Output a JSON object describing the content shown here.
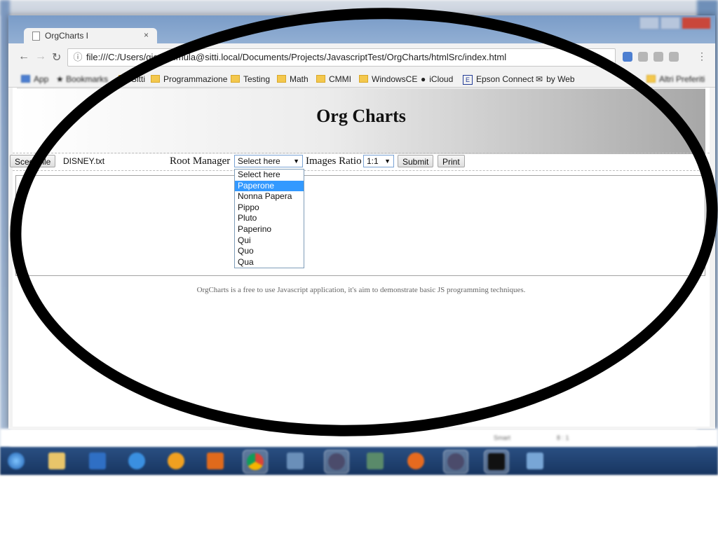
{
  "browser": {
    "tab_title": "OrgCharts I",
    "tab_close": "×",
    "url": "file:///C:/Users/giorgio.mula@sitti.local/Documents/Projects/JavascriptTest/OrgCharts/htmlSrc/index.html",
    "info_glyph": "ⓘ",
    "bookmarks": [
      "App",
      "Bookmarks",
      "Sitti",
      "Programmazione",
      "Testing",
      "Math",
      "CMMI",
      "WindowsCE",
      "iCloud",
      "Epson Connect",
      "by Web",
      "Altri Preferiti"
    ]
  },
  "page": {
    "title": "Org Charts",
    "file_button": "Scegli file",
    "file_name": "DISNEY.txt",
    "root_manager_label": "Root Manager",
    "root_manager_value": "Select here",
    "images_ratio_label": "Images Ratio",
    "images_ratio_value": "1:1",
    "submit_label": "Submit",
    "print_label": "Print",
    "footer": "OrgCharts is a free to use Javascript application, it's aim to demonstrate basic JS programming techniques."
  },
  "dropdown": {
    "options": [
      "Select here",
      "Paperone",
      "Nonna Papera",
      "Pippo",
      "Pluto",
      "Paperino",
      "Qui",
      "Quo",
      "Qua"
    ],
    "highlighted": "Paperone"
  },
  "status_strip": {
    "cells": [
      "Smart",
      "8 : 1"
    ]
  },
  "colors": {
    "highlight": "#3399ff",
    "taskbar": "#1f3f6e",
    "oval": "#000000"
  }
}
